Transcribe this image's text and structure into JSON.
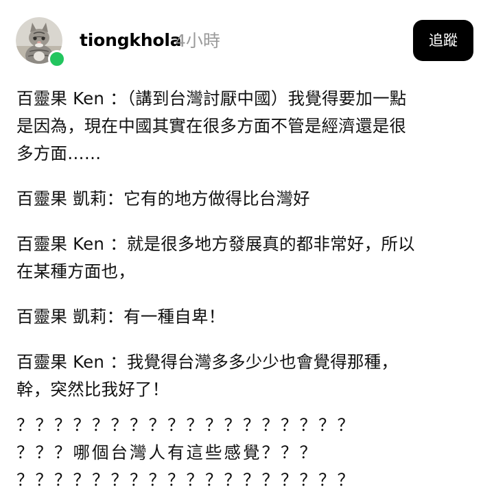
{
  "post": {
    "username": "tiongkhola",
    "time": "4小時",
    "follow_label": "追蹤",
    "avatar_icon": "cat-avatar",
    "online_color": "#22c55e"
  },
  "paragraphs": [
    "百靈果 Ken ：（講到台灣討厭中國）我覺得要加一點\n是因為，現在中國其實在很多方面不管是經濟還是很\n多方面……",
    "百靈果 凱莉：它有的地方做得比台灣好",
    "百靈果 Ken ：就是很多地方發展真的都非常好，所以\n在某種方面也，",
    "百靈果 凱莉：有一種自卑！",
    "百靈果 Ken ：我覺得台灣多多少少也會覺得那種，\n幹，突然比我好了！"
  ],
  "question_lines": [
    "？？？？？？？？？？？？？？？？？？",
    "？？？哪個台灣人有這些感覺？？？",
    "？？？？？？？？？？？？？？？？？？"
  ]
}
